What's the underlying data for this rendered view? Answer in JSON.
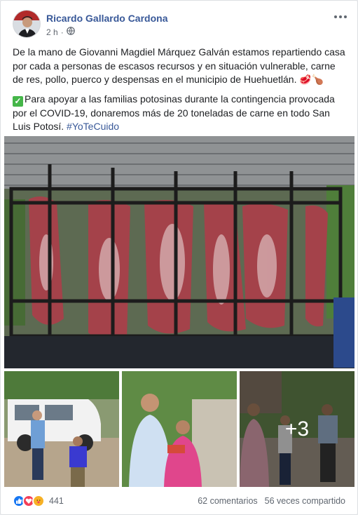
{
  "post": {
    "author": "Ricardo Gallardo Cardona",
    "time": "2 h",
    "privacy_icon": "globe-icon",
    "paragraph1": "De la mano de Giovanni Magdiel Márquez Galván estamos repartiendo casa por cada a personas de escasos recursos y en situación vulnerable, carne de res, pollo, puerco y despensas en el municipio de Huehuetlán. 🥩🍗",
    "paragraph2": "Para apoyar a las familias potosinas durante la contingencia provocada por el COVID-19, donaremos más de 20 toneladas de carne en todo San Luis Potosí.",
    "hashtag": "#YoTeCuido",
    "extra_photos": "+3"
  },
  "footer": {
    "reactions": [
      "like-icon",
      "love-icon",
      "care-icon"
    ],
    "reaction_count": "441",
    "comments": "62 comentarios",
    "shares": "56 veces compartido"
  },
  "colors": {
    "link": "#385898",
    "like": "#1877f2",
    "love": "#f33e58",
    "care": "#f7b125"
  }
}
